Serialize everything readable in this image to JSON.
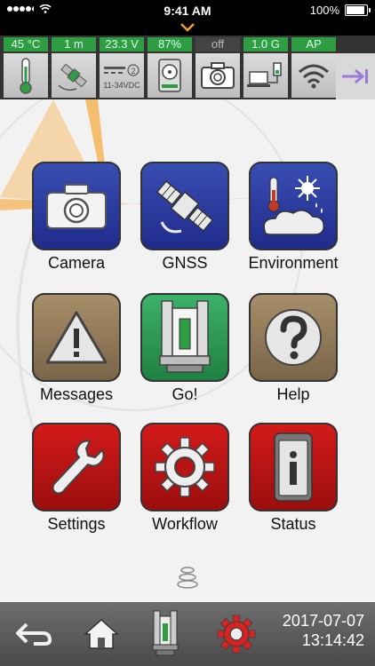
{
  "ios_status": {
    "time": "9:41 AM",
    "battery": "100%"
  },
  "readouts": [
    {
      "label": "45 °C",
      "active": true
    },
    {
      "label": "1 m",
      "active": true
    },
    {
      "label": "23.3 V",
      "active": true
    },
    {
      "label": "87%",
      "active": true
    },
    {
      "label": "off",
      "active": false
    },
    {
      "label": "1.0 G",
      "active": true
    },
    {
      "label": "AP",
      "active": true
    }
  ],
  "strip_icons": {
    "power_label": "11-34VDC"
  },
  "tiles": [
    {
      "label": "Camera",
      "color": "blue",
      "icon": "camera-icon"
    },
    {
      "label": "GNSS",
      "color": "blue",
      "icon": "satellite-icon"
    },
    {
      "label": "Environment",
      "color": "blue",
      "icon": "environment-icon"
    },
    {
      "label": "Messages",
      "color": "brown",
      "icon": "warning-icon"
    },
    {
      "label": "Go!",
      "color": "green",
      "icon": "scanner-icon"
    },
    {
      "label": "Help",
      "color": "brown",
      "icon": "help-icon"
    },
    {
      "label": "Settings",
      "color": "red",
      "icon": "wrench-icon"
    },
    {
      "label": "Workflow",
      "color": "red",
      "icon": "gear-icon"
    },
    {
      "label": "Status",
      "color": "red",
      "icon": "status-device-icon"
    }
  ],
  "bottom_bar": {
    "date": "2017-07-07",
    "time": "13:14:42"
  },
  "colors": {
    "accent_orange": "#f0a030",
    "readout_green": "#2f9e43",
    "exit_arrow": "#9b7bd8"
  }
}
